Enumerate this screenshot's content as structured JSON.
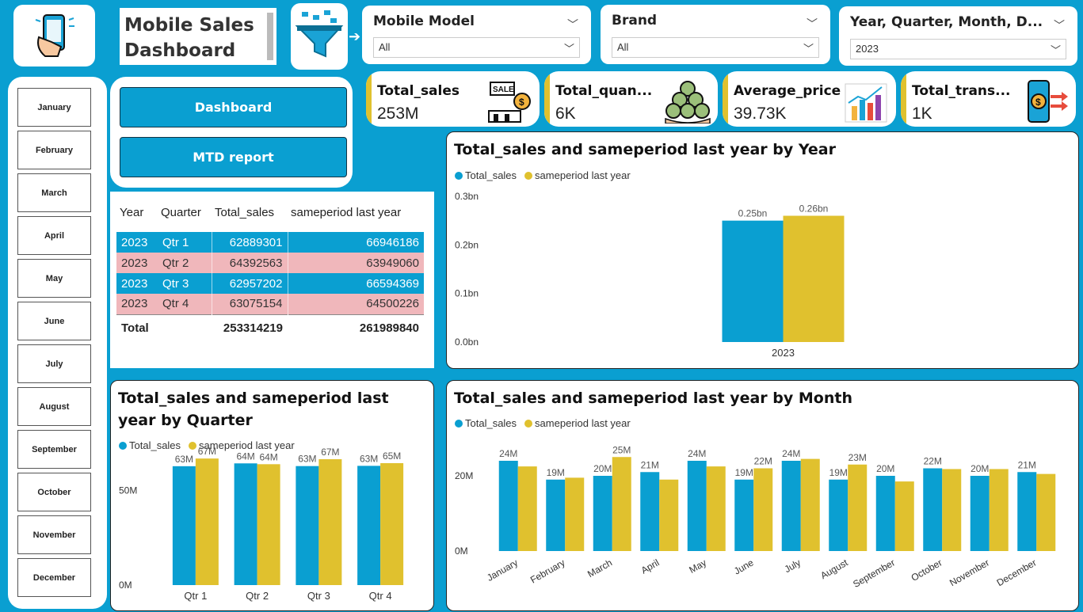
{
  "header": {
    "title_line1": "Mobile Sales",
    "title_line2": "Dashboard"
  },
  "slicers": [
    {
      "title": "Mobile Model",
      "value": "All"
    },
    {
      "title": "Brand",
      "value": "All"
    },
    {
      "title": "Year, Quarter, Month, D...",
      "value": "2023"
    }
  ],
  "months": [
    "January",
    "February",
    "March",
    "April",
    "May",
    "June",
    "July",
    "August",
    "September",
    "October",
    "November",
    "December"
  ],
  "nav": {
    "dashboard": "Dashboard",
    "mtd": "MTD report"
  },
  "kpis": [
    {
      "label": "Total_sales",
      "value": "253M",
      "icon": "sale-icon"
    },
    {
      "label": "Total_quan...",
      "value": "6K",
      "icon": "coins-icon"
    },
    {
      "label": "Average_price",
      "value": "39.73K",
      "icon": "bar-chart-icon"
    },
    {
      "label": "Total_trans...",
      "value": "1K",
      "icon": "mobile-payment-icon"
    }
  ],
  "table": {
    "headers": [
      "Year",
      "Quarter",
      "Total_sales",
      "sameperiod last year"
    ],
    "rows": [
      [
        "2023",
        "Qtr 1",
        "62889301",
        "66946186"
      ],
      [
        "2023",
        "Qtr 2",
        "64392563",
        "63949060"
      ],
      [
        "2023",
        "Qtr 3",
        "62957202",
        "66594369"
      ],
      [
        "2023",
        "Qtr 4",
        "63075154",
        "64500226"
      ]
    ],
    "total": [
      "Total",
      "253314219",
      "261989840"
    ]
  },
  "colors": {
    "total_sales": "#0a9fd1",
    "sameperiod": "#e0c12e"
  },
  "chart_data": [
    {
      "type": "bar",
      "title": "Total_sales and sameperiod last year by Year",
      "categories": [
        "2023"
      ],
      "series": [
        {
          "name": "Total_sales",
          "values": [
            0.25
          ],
          "labels": [
            "0.25bn"
          ]
        },
        {
          "name": "sameperiod last year",
          "values": [
            0.26
          ],
          "labels": [
            "0.26bn"
          ]
        }
      ],
      "yticks": [
        "0.0bn",
        "0.1bn",
        "0.2bn",
        "0.3bn"
      ],
      "ylim": [
        0,
        0.3
      ]
    },
    {
      "type": "bar",
      "title": "Total_sales and sameperiod last year by Quarter",
      "categories": [
        "Qtr 1",
        "Qtr 2",
        "Qtr 3",
        "Qtr 4"
      ],
      "series": [
        {
          "name": "Total_sales",
          "values": [
            62.89,
            64.39,
            62.96,
            63.08
          ],
          "labels": [
            "63M",
            "64M",
            "63M",
            "63M"
          ]
        },
        {
          "name": "sameperiod last year",
          "values": [
            66.95,
            63.95,
            66.59,
            64.5
          ],
          "labels": [
            "67M",
            "64M",
            "67M",
            "65M"
          ]
        }
      ],
      "yticks": [
        "0M",
        "50M"
      ],
      "ylim": [
        0,
        80
      ]
    },
    {
      "type": "bar",
      "title": "Total_sales and sameperiod last year by Month",
      "categories": [
        "January",
        "February",
        "March",
        "April",
        "May",
        "June",
        "July",
        "August",
        "September",
        "October",
        "November",
        "December"
      ],
      "series": [
        {
          "name": "Total_sales",
          "values": [
            24,
            19,
            20,
            21,
            24,
            19,
            24,
            19,
            20,
            22,
            20,
            21
          ],
          "labels": [
            "24M",
            "19M",
            "20M",
            "21M",
            "24M",
            "19M",
            "24M",
            "19M",
            "20M",
            "22M",
            "20M",
            "21M"
          ]
        },
        {
          "name": "sameperiod last year",
          "values": [
            22.5,
            19.5,
            25,
            19,
            22.5,
            22,
            24.5,
            23,
            18.5,
            21.8,
            21.8,
            20.5
          ],
          "labels": [
            "",
            "",
            "25M",
            "",
            "",
            "22M",
            "",
            "23M",
            "",
            "",
            "",
            ""
          ]
        }
      ],
      "yticks": [
        "0M",
        "20M"
      ],
      "ylim": [
        0,
        28
      ]
    }
  ]
}
